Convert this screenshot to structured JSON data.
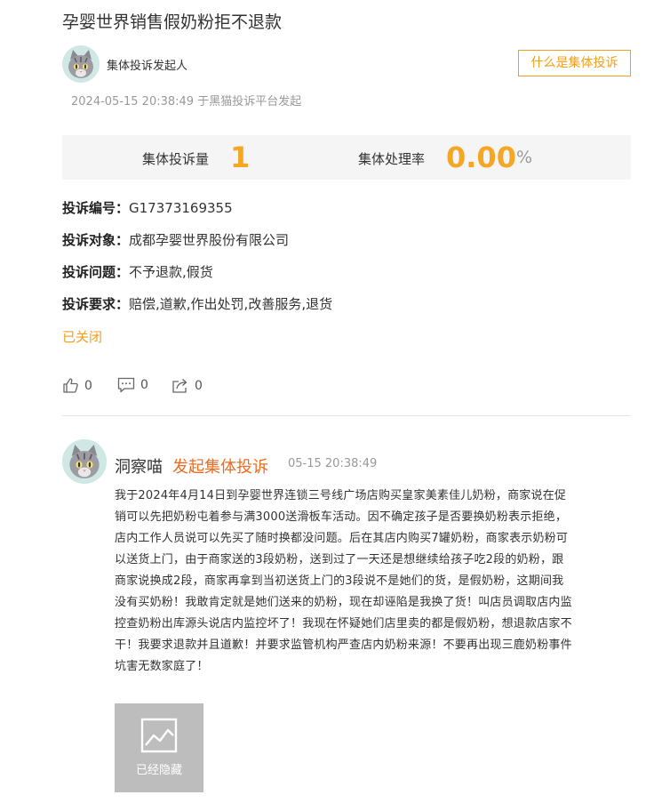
{
  "complaint": {
    "title": "孕婴世界销售假奶粉拒不退款",
    "initiator": {
      "avatar_icon": "cat-avatar-icon",
      "label": "集体投诉发起人"
    },
    "what_button": "什么是集体投诉",
    "meta": "2024-05-15 20:38:49 于黑猫投诉平台发起",
    "stats": {
      "count_label": "集体投诉量",
      "count_value": "1",
      "rate_label": "集体处理率",
      "rate_value": "0.00",
      "rate_unit": "%"
    },
    "fields": [
      {
        "label": "投诉编号：",
        "value": "G17373169355"
      },
      {
        "label": "投诉对象：",
        "value": "成都孕婴世界股份有限公司"
      },
      {
        "label": "投诉问题：",
        "value": "不予退款,假货"
      },
      {
        "label": "投诉要求：",
        "value": "赔偿,道歉,作出处罚,改善服务,退货"
      }
    ],
    "status": "已关闭",
    "actions": {
      "like_count": "0",
      "comment_count": "0",
      "share_count": "0"
    }
  },
  "post": {
    "user": "洞察喵",
    "action": "发起集体投诉",
    "time": "05-15 20:38:49",
    "body_lines": [
      "我于2024年4月14日到孕婴世界连锁三号线广场店购买皇家美素佳儿奶粉，商家说在促",
      "销可以先把奶粉屯着参与满3000送滑板车活动。因不确定孩子是否要换奶粉表示拒绝，",
      "店内工作人员说可以先买了随时换都没问题。后在其店内购买7罐奶粉，商家表示奶粉可",
      "以送货上门，由于商家送的3段奶粉，送到过了一天还是想继续给孩子吃2段的奶粉，跟",
      "商家说换成2段，商家再拿到当初送货上门的3段说不是她们的货，是假奶粉，这期间我",
      "没有买奶粉！我敢肯定就是她们送来的奶粉，现在却诬陷是我换了货！叫店员调取店内监",
      "控查奶粉出库源头说店内监控坏了！我现在怀疑她们店里卖的都是假奶粉，想退款店家不",
      "干！我要求退款并且道歉！并要求监管机构严查店内奶粉来源！不要再出现三鹿奶粉事件",
      "坑害无数家庭了！"
    ],
    "image_placeholder": "已经隐藏",
    "colors": {
      "accent_orange": "#f0a01e",
      "stat_value": "#f5a623",
      "action_orange": "#f06a1e"
    }
  }
}
